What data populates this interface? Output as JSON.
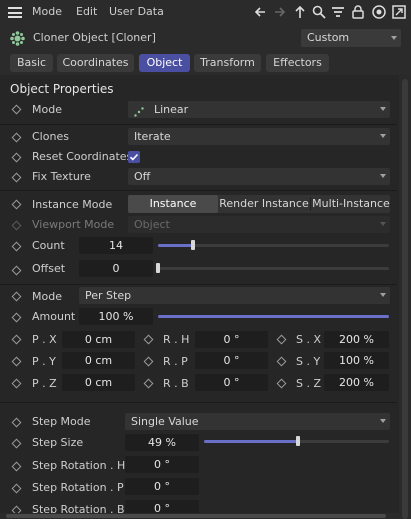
{
  "menubar": {
    "items": [
      "Mode",
      "Edit",
      "User Data"
    ],
    "icons": [
      "back-arrow",
      "forward-arrow",
      "up-arrow",
      "search",
      "filter",
      "lock",
      "target",
      "expand"
    ]
  },
  "titlebar": {
    "title": "Cloner Object [Cloner]",
    "preset": "Custom"
  },
  "tabs": [
    "Basic",
    "Coordinates",
    "Object",
    "Transform",
    "Effectors"
  ],
  "active_tab": "Object",
  "section_title": "Object Properties",
  "mode": {
    "label": "Mode",
    "value": "Linear"
  },
  "clones": {
    "label": "Clones",
    "value": "Iterate"
  },
  "reset_coordinates": {
    "label": "Reset Coordinates",
    "checked": true
  },
  "fix_texture": {
    "label": "Fix Texture",
    "value": "Off"
  },
  "instance_mode": {
    "label": "Instance Mode",
    "options": [
      "Instance",
      "Render Instance",
      "Multi-Instance"
    ],
    "selected": "Instance"
  },
  "viewport_mode": {
    "label": "Viewport Mode",
    "value": "Object"
  },
  "count": {
    "label": "Count",
    "value": "14",
    "slider_fraction": 0.15
  },
  "offset": {
    "label": "Offset",
    "value": "0",
    "slider_fraction": 0.0
  },
  "mode2": {
    "label": "Mode",
    "value": "Per Step"
  },
  "amount": {
    "label": "Amount",
    "value": "100 %",
    "slider_fraction": 1.0
  },
  "position": {
    "x": {
      "label": "P . X",
      "value": "0 cm"
    },
    "y": {
      "label": "P . Y",
      "value": "0 cm"
    },
    "z": {
      "label": "P . Z",
      "value": "0 cm"
    }
  },
  "rotation": {
    "h": {
      "label": "R . H",
      "value": "0 °"
    },
    "p": {
      "label": "R . P",
      "value": "0 °"
    },
    "b": {
      "label": "R . B",
      "value": "0 °"
    }
  },
  "scale": {
    "x": {
      "label": "S . X",
      "value": "200 %"
    },
    "y": {
      "label": "S . Y",
      "value": "100 %"
    },
    "z": {
      "label": "S . Z",
      "value": "200 %"
    }
  },
  "step_mode": {
    "label": "Step Mode",
    "value": "Single Value"
  },
  "step_size": {
    "label": "Step Size",
    "value": "49 %",
    "slider_fraction": 0.51
  },
  "step_rotation_h": {
    "label": "Step Rotation . H",
    "value": "0 °"
  },
  "step_rotation_p": {
    "label": "Step Rotation . P",
    "value": "0 °"
  },
  "step_rotation_b": {
    "label": "Step Rotation . B",
    "value": "0 °"
  }
}
